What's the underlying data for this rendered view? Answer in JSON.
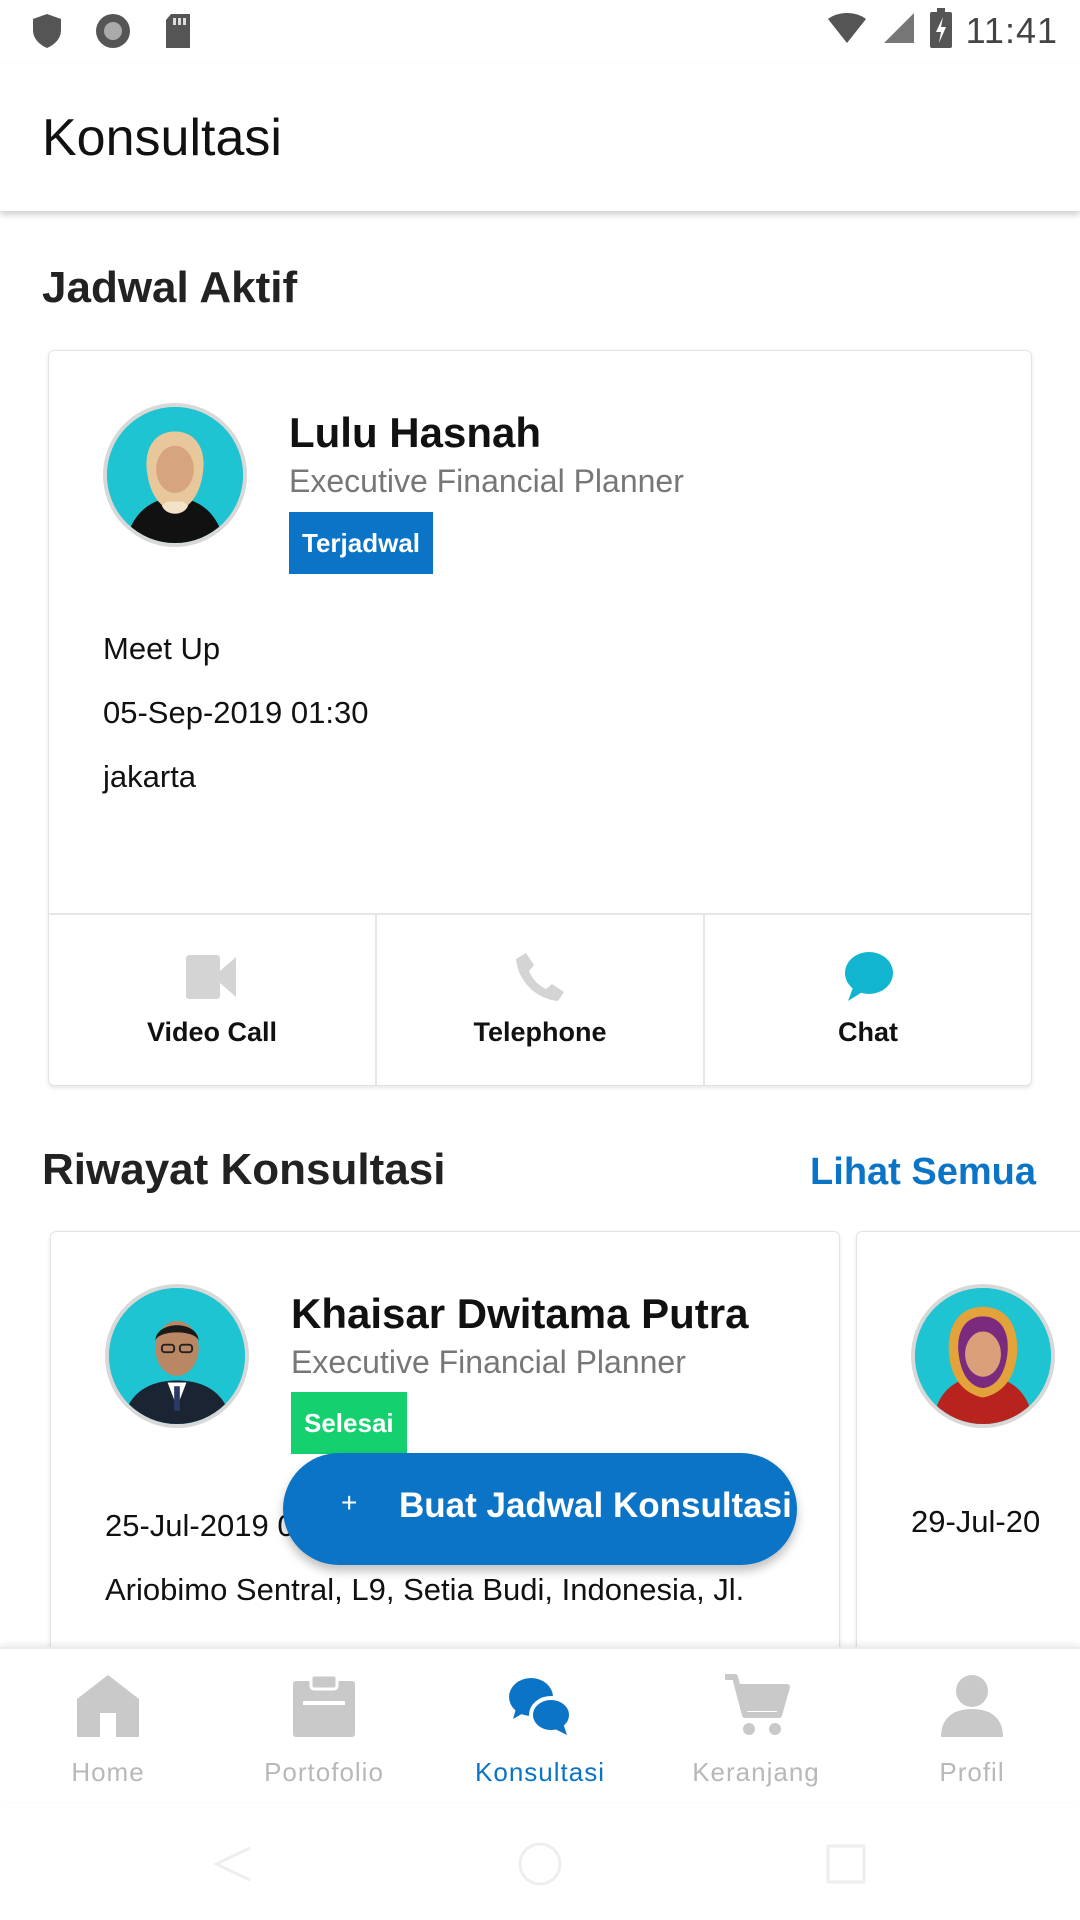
{
  "status_bar": {
    "time": "11:41"
  },
  "app_bar": {
    "title": "Konsultasi"
  },
  "jadwal_aktif": {
    "title": "Jadwal Aktif",
    "card": {
      "name": "Lulu Hasnah",
      "role": "Executive Financial Planner",
      "badge": "Terjadwal",
      "type": "Meet Up",
      "datetime": "05-Sep-2019 01:30",
      "location": "jakarta",
      "actions": [
        {
          "label": "Video Call",
          "icon": "video-camera-icon"
        },
        {
          "label": "Telephone",
          "icon": "phone-icon"
        },
        {
          "label": "Chat",
          "icon": "chat-bubble-icon"
        }
      ]
    }
  },
  "riwayat": {
    "title": "Riwayat Konsultasi",
    "see_all": "Lihat Semua",
    "items": [
      {
        "name": "Khaisar Dwitama Putra",
        "role": "Executive Financial Planner",
        "badge": "Selesai",
        "datetime": "25-Jul-2019 0",
        "location": "Ariobimo Sentral, L9, Setia Budi, Indonesia, Jl."
      },
      {
        "datetime": "29-Jul-20"
      }
    ]
  },
  "fab": {
    "icon": "plus-icon",
    "label": "Buat Jadwal Konsultasi"
  },
  "bottom_nav": {
    "items": [
      {
        "label": "Home",
        "icon": "home-icon"
      },
      {
        "label": "Portofolio",
        "icon": "clipboard-icon"
      },
      {
        "label": "Konsultasi",
        "icon": "chat-bubbles-icon",
        "active": true
      },
      {
        "label": "Keranjang",
        "icon": "cart-icon"
      },
      {
        "label": "Profil",
        "icon": "person-icon"
      }
    ]
  },
  "colors": {
    "primary": "#0b74c7",
    "success": "#14d06e",
    "chat": "#12b5cf",
    "inactive": "#b8b8b8"
  }
}
